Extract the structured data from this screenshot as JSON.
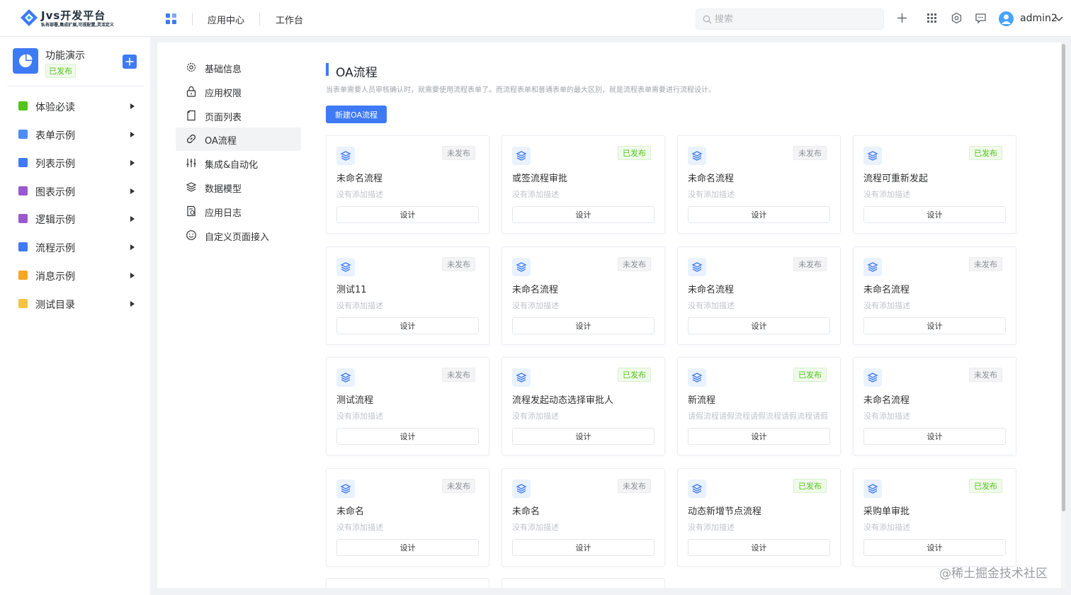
{
  "header": {
    "logo_title": "Jvs开发平台",
    "logo_subtitle": "私有部署,集成扩展,可视配置,灵活定义",
    "nav": [
      {
        "label": "应用中心"
      },
      {
        "label": "工作台"
      }
    ],
    "search_placeholder": "搜索",
    "username": "admin2"
  },
  "sidebar": {
    "app_name": "功能演示",
    "app_status": "已发布",
    "items": [
      {
        "label": "体验必读",
        "color": "#52c41a"
      },
      {
        "label": "表单示例",
        "color": "#4a8df8"
      },
      {
        "label": "列表示例",
        "color": "#3e7af6"
      },
      {
        "label": "图表示例",
        "color": "#9b59d0"
      },
      {
        "label": "逻辑示例",
        "color": "#9b59d0"
      },
      {
        "label": "流程示例",
        "color": "#3e7af6"
      },
      {
        "label": "消息示例",
        "color": "#f5a623"
      },
      {
        "label": "测试目录",
        "color": "#f5c342"
      }
    ]
  },
  "submenu": [
    {
      "label": "基础信息",
      "icon": "gear-icon"
    },
    {
      "label": "应用权限",
      "icon": "lock-icon"
    },
    {
      "label": "页面列表",
      "icon": "page-icon"
    },
    {
      "label": "OA流程",
      "icon": "link-icon",
      "active": true
    },
    {
      "label": "集成&自动化",
      "icon": "sliders-icon"
    },
    {
      "label": "数据模型",
      "icon": "layers-icon"
    },
    {
      "label": "应用日志",
      "icon": "log-icon"
    },
    {
      "label": "自定义页面接入",
      "icon": "smile-icon"
    }
  ],
  "main": {
    "title": "OA流程",
    "description": "当表单需要人员审核确认时，就需要使用流程表单了。而流程表单和普通表单的最大区别，就是流程表单需要进行流程设计。",
    "new_button": "新建OA流程",
    "design_label": "设计",
    "cards": [
      {
        "name": "未命名流程",
        "status": "未发布",
        "published": false,
        "desc": "没有添加描述"
      },
      {
        "name": "或签流程审批",
        "status": "已发布",
        "published": true,
        "desc": "没有添加描述"
      },
      {
        "name": "未命名流程",
        "status": "未发布",
        "published": false,
        "desc": "没有添加描述"
      },
      {
        "name": "流程可重新发起",
        "status": "已发布",
        "published": true,
        "desc": "没有添加描述"
      },
      {
        "name": "测试11",
        "status": "未发布",
        "published": false,
        "desc": "没有添加描述"
      },
      {
        "name": "未命名流程",
        "status": "未发布",
        "published": false,
        "desc": "没有添加描述"
      },
      {
        "name": "未命名流程",
        "status": "未发布",
        "published": false,
        "desc": "没有添加描述"
      },
      {
        "name": "未命名流程",
        "status": "未发布",
        "published": false,
        "desc": "没有添加描述"
      },
      {
        "name": "测试流程",
        "status": "未发布",
        "published": false,
        "desc": "没有添加描述"
      },
      {
        "name": "流程发起动态选择审批人",
        "status": "已发布",
        "published": true,
        "desc": "没有添加描述"
      },
      {
        "name": "新流程",
        "status": "已发布",
        "published": true,
        "desc": "请假流程请假流程请假流程请假流程请假"
      },
      {
        "name": "未命名流程",
        "status": "未发布",
        "published": false,
        "desc": "没有添加描述"
      },
      {
        "name": "未命名",
        "status": "未发布",
        "published": false,
        "desc": "没有添加描述"
      },
      {
        "name": "未命名",
        "status": "未发布",
        "published": false,
        "desc": "没有添加描述"
      },
      {
        "name": "动态新增节点流程",
        "status": "已发布",
        "published": true,
        "desc": "没有添加描述"
      },
      {
        "name": "采购单审批",
        "status": "已发布",
        "published": true,
        "desc": "没有添加描述"
      }
    ]
  },
  "footer_watermark": "@稀土掘金技术社区"
}
